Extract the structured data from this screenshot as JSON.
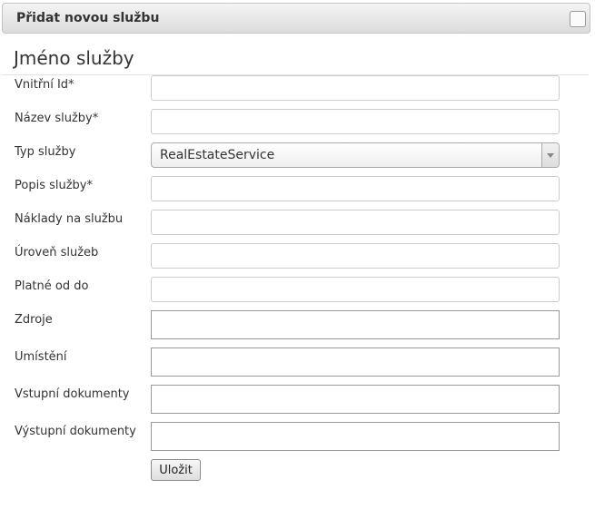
{
  "panel": {
    "title": "Přidat novou službu"
  },
  "section": {
    "title": "Jméno služby"
  },
  "fields": [
    {
      "label": "Vnitřní Id*",
      "value": ""
    },
    {
      "label": "Název služby*",
      "value": ""
    },
    {
      "label": "Typ služby",
      "value": "RealEstateService"
    },
    {
      "label": "Popis služby*",
      "value": ""
    },
    {
      "label": "Náklady na službu",
      "value": ""
    },
    {
      "label": "Úroveň služeb",
      "value": ""
    },
    {
      "label": "Platné od do",
      "value": ""
    },
    {
      "label": "Zdroje",
      "value": ""
    },
    {
      "label": "Umístění",
      "value": ""
    },
    {
      "label": "Vstupní dokumenty",
      "value": ""
    },
    {
      "label": "Výstupní dokumenty",
      "value": ""
    }
  ],
  "actions": {
    "save_label": "Uložit"
  }
}
